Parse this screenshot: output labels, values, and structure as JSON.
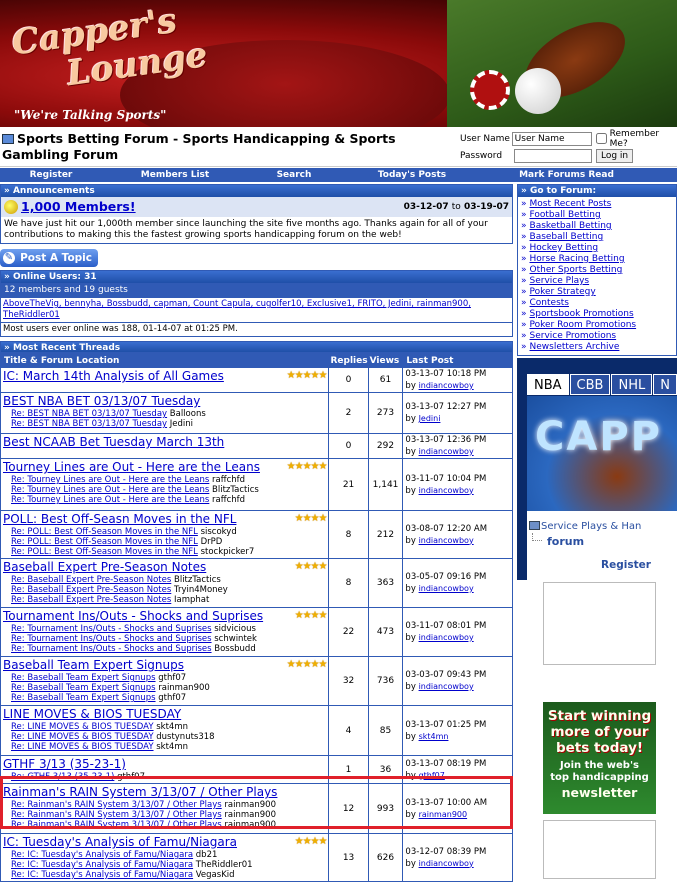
{
  "banner": {
    "logo_line1": "Capper's",
    "logo_line2": "Lounge",
    "tagline": "\"We're Talking Sports\""
  },
  "header": {
    "title": "Sports Betting Forum - Sports Handicapping & Sports Gambling Forum"
  },
  "login": {
    "username_label": "User Name",
    "username_value": "User Name",
    "password_label": "Password",
    "remember_label": "Remember Me?",
    "login_button": "Log in"
  },
  "nav": {
    "items": [
      "Register",
      "Members List",
      "Search",
      "Today's Posts",
      "Mark Forums Read"
    ]
  },
  "announcements": {
    "header": "» Announcements",
    "title": "1,000 Members!",
    "date_from": "03-12-07",
    "date_to_word": "to",
    "date_to": "03-19-07",
    "body": "We have just hit our 1,000th member since launching the site five months ago. Thanks again for all of your contributions to making this the fastest growing sports handicapping forum on the web!"
  },
  "post_topic": "Post A Topic",
  "online": {
    "header": "» Online Users: 31",
    "summary": "12 members and 19 guests",
    "names": "AboveTheVig, bennyha, Bossbudd, capman, Count Capula, cugolfer10, Exclusive1, FRITO, Jedini, rainman900, TheRiddler01",
    "most": "Most users ever online was 188, 01-14-07 at 01:25 PM."
  },
  "threads": {
    "header": "» Most Recent Threads",
    "columns": {
      "title": "Title & Forum Location",
      "replies": "Replies",
      "views": "Views",
      "last": "Last Post"
    },
    "rows": [
      {
        "title": "IC: March 14th Analysis of All Games",
        "stars": "★★★★★",
        "replies": "0",
        "views": "61",
        "date": "03-13-07 10:18 PM",
        "by": "by",
        "user": "indiancowboy",
        "subs": []
      },
      {
        "title": "BEST NBA BET 03/13/07 Tuesday",
        "stars": "",
        "replies": "2",
        "views": "273",
        "date": "03-13-07 12:27 PM",
        "by": "by",
        "user": "Jedini",
        "subs": [
          {
            "t": "Re: BEST NBA BET 03/13/07 Tuesday",
            "u": "Balloons"
          },
          {
            "t": "Re: BEST NBA BET 03/13/07 Tuesday",
            "u": "Jedini"
          }
        ]
      },
      {
        "title": "Best NCAAB Bet Tuesday March 13th",
        "stars": "",
        "replies": "0",
        "views": "292",
        "date": "03-13-07 12:36 PM",
        "by": "by",
        "user": "indiancowboy",
        "subs": []
      },
      {
        "title": "Tourney Lines are Out - Here are the Leans",
        "stars": "★★★★★",
        "replies": "21",
        "views": "1,141",
        "date": "03-11-07 10:04 PM",
        "by": "by",
        "user": "indiancowboy",
        "subs": [
          {
            "t": "Re: Tourney Lines are Out - Here are the Leans",
            "u": "raffchfd"
          },
          {
            "t": "Re: Tourney Lines are Out - Here are the Leans",
            "u": "BlitzTactics"
          },
          {
            "t": "Re: Tourney Lines are Out - Here are the Leans",
            "u": "raffchfd"
          }
        ]
      },
      {
        "title": "POLL: Best Off-Seasn Moves in the NFL",
        "stars": "★★★★",
        "replies": "8",
        "views": "212",
        "date": "03-08-07 12:20 AM",
        "by": "by",
        "user": "indiancowboy",
        "subs": [
          {
            "t": "Re: POLL: Best Off-Season Moves in the NFL",
            "u": "siscokyd"
          },
          {
            "t": "Re: POLL: Best Off-Season Moves in the NFL",
            "u": "DrPD"
          },
          {
            "t": "Re: POLL: Best Off-Season Moves in the NFL",
            "u": "stockpicker7"
          }
        ]
      },
      {
        "title": "Baseball Expert Pre-Season Notes",
        "stars": "★★★★",
        "replies": "8",
        "views": "363",
        "date": "03-05-07 09:16 PM",
        "by": "by",
        "user": "indiancowboy",
        "subs": [
          {
            "t": "Re: Baseball Expert Pre-Season Notes",
            "u": "BlitzTactics"
          },
          {
            "t": "Re: Baseball Expert Pre-Season Notes",
            "u": "Tryin4Money"
          },
          {
            "t": "Re: Baseball Expert Pre-Season Notes",
            "u": "Iamphat"
          }
        ]
      },
      {
        "title": "Tournament Ins/Outs - Shocks and Suprises",
        "stars": "★★★★",
        "replies": "22",
        "views": "473",
        "date": "03-11-07 08:01 PM",
        "by": "by",
        "user": "indiancowboy",
        "subs": [
          {
            "t": "Re: Tournament Ins/Outs - Shocks and Suprises",
            "u": "sidvicious"
          },
          {
            "t": "Re: Tournament Ins/Outs - Shocks and Suprises",
            "u": "schwintek"
          },
          {
            "t": "Re: Tournament Ins/Outs - Shocks and Suprises",
            "u": "Bossbudd"
          }
        ]
      },
      {
        "title": "Baseball Team Expert Signups",
        "stars": "★★★★★",
        "replies": "32",
        "views": "736",
        "date": "03-03-07 09:43 PM",
        "by": "by",
        "user": "indiancowboy",
        "subs": [
          {
            "t": "Re: Baseball Team Expert Signups",
            "u": "gthf07"
          },
          {
            "t": "Re: Baseball Team Expert Signups",
            "u": "rainman900"
          },
          {
            "t": "Re: Baseball Team Expert Signups",
            "u": "gthf07"
          }
        ]
      },
      {
        "title": "LINE MOVES & BIOS TUESDAY",
        "stars": "",
        "replies": "4",
        "views": "85",
        "date": "03-13-07 01:25 PM",
        "by": "by",
        "user": "skt4mn",
        "subs": [
          {
            "t": "Re: LINE MOVES & BIOS TUESDAY",
            "u": "skt4mn"
          },
          {
            "t": "Re: LINE MOVES & BIOS TUESDAY",
            "u": "dustynuts318"
          },
          {
            "t": "Re: LINE MOVES & BIOS TUESDAY",
            "u": "skt4mn"
          }
        ]
      },
      {
        "title": "GTHF 3/13 (35-23-1)",
        "stars": "",
        "replies": "1",
        "views": "36",
        "date": "03-13-07 08:19 PM",
        "by": "by",
        "user": "gthf07",
        "subs": [
          {
            "t": "Re: GTHF 3/13 (35-23-1)",
            "u": "gthf07"
          }
        ]
      },
      {
        "title": "Rainman's RAIN System 3/13/07 / Other Plays",
        "stars": "",
        "replies": "12",
        "views": "993",
        "date": "03-13-07 10:00 AM",
        "by": "by",
        "user": "rainman900",
        "subs": [
          {
            "t": "Re: Rainman's RAIN System 3/13/07 / Other Plays",
            "u": "rainman900"
          },
          {
            "t": "Re: Rainman's RAIN System 3/13/07 / Other Plays",
            "u": "rainman900"
          },
          {
            "t": "Re: Rainman's RAIN System 3/13/07 / Other Plays",
            "u": "rainman900"
          }
        ]
      },
      {
        "title": "IC: Tuesday's Analysis of Famu/Niagara",
        "stars": "★★★★",
        "replies": "13",
        "views": "626",
        "date": "03-12-07 08:39 PM",
        "by": "by",
        "user": "indiancowboy",
        "subs": [
          {
            "t": "Re: IC: Tuesday's Analysis of Famu/Niagara",
            "u": "db21"
          },
          {
            "t": "Re: IC: Tuesday's Analysis of Famu/Niagara",
            "u": "TheRiddler01"
          },
          {
            "t": "Re: IC: Tuesday's Analysis of Famu/Niagara",
            "u": "VegasKid"
          }
        ]
      }
    ]
  },
  "goto": {
    "header": "» Go to Forum:",
    "items": [
      "Most Recent Posts",
      "Football Betting",
      "Basketball Betting",
      "Baseball Betting",
      "Hockey Betting",
      "Horse Racing Betting",
      "Other Sports Betting",
      "Service Plays",
      "Poker Strategy",
      "Contests",
      "Sportsbook Promotions",
      "Poker Room Promotions",
      "Service Promotions",
      "Newsletters Archive"
    ]
  },
  "widget": {
    "tabs": [
      "NBA",
      "CBB",
      "NHL",
      "N"
    ],
    "art_text": "CAPP",
    "service_link": "Service Plays & Han",
    "forum_link": "forum",
    "register": "Register"
  },
  "ad": {
    "line1a": "Start winning",
    "line1b": "more of your",
    "line1c": "bets today!",
    "line2a": "Join the web's",
    "line2b": "top handicapping",
    "line3": "newsletter"
  }
}
